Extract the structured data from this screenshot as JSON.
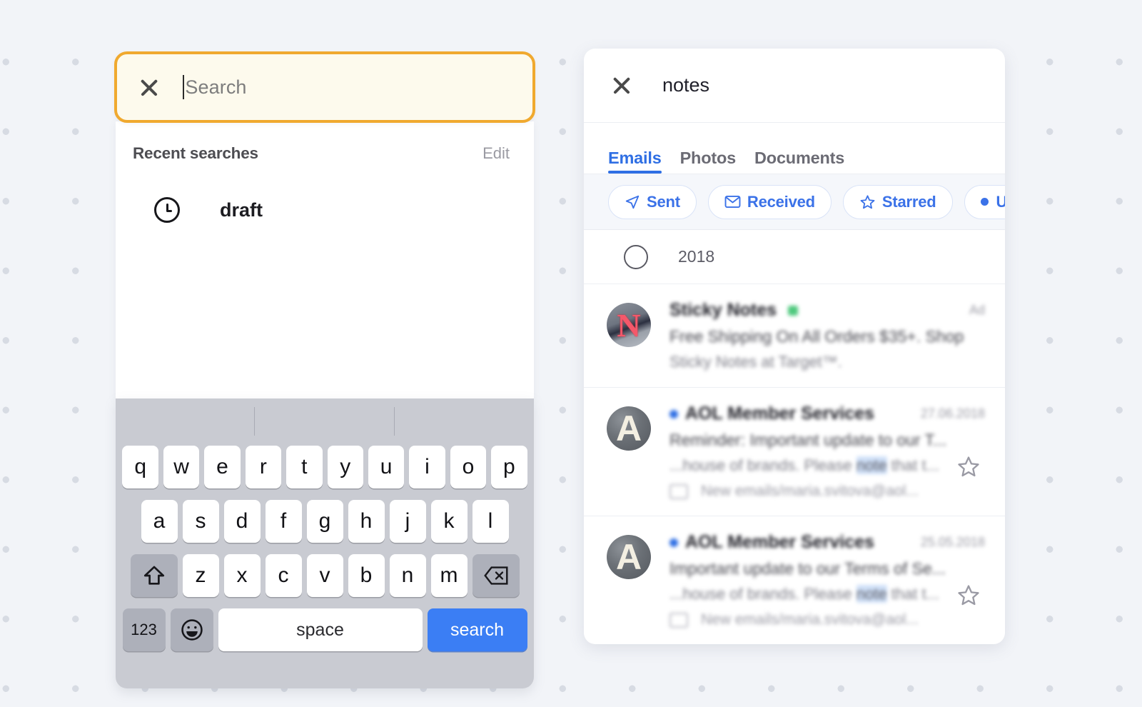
{
  "left_panel": {
    "search": {
      "close_icon": "close-icon",
      "placeholder": "Search",
      "value": ""
    },
    "recent": {
      "title": "Recent searches",
      "edit_label": "Edit",
      "items": [
        {
          "icon": "clock-icon",
          "label": "draft"
        }
      ]
    },
    "keyboard": {
      "rows": [
        [
          "q",
          "w",
          "e",
          "r",
          "t",
          "y",
          "u",
          "i",
          "o",
          "p"
        ],
        [
          "a",
          "s",
          "d",
          "f",
          "g",
          "h",
          "j",
          "k",
          "l"
        ],
        [
          "z",
          "x",
          "c",
          "v",
          "b",
          "n",
          "m"
        ]
      ],
      "shift_icon": "shift-icon",
      "backspace_icon": "backspace-icon",
      "numbers_label": "123",
      "emoji_icon": "emoji-icon",
      "space_label": "space",
      "search_label": "search"
    }
  },
  "right_panel": {
    "header": {
      "close_icon": "close-icon",
      "query": "notes"
    },
    "tabs": [
      {
        "label": "Emails",
        "active": true
      },
      {
        "label": "Photos",
        "active": false
      },
      {
        "label": "Documents",
        "active": false
      }
    ],
    "filter_chips": [
      {
        "label": "Sent",
        "icon": "send-icon"
      },
      {
        "label": "Received",
        "icon": "envelope-icon"
      },
      {
        "label": "Starred",
        "icon": "star-icon"
      },
      {
        "label": "Unread",
        "icon": "dot-icon"
      }
    ],
    "year_group": {
      "checkbox_icon": "circle-checkbox-icon",
      "label": "2018"
    },
    "emails": [
      {
        "avatar_letter": "N",
        "avatar_type": "netflix",
        "unread": false,
        "sender": "Sticky Notes",
        "badge": "green-verified-badge",
        "meta": "Ad",
        "subject": "Free Shipping On All Orders $35+. Shop",
        "snippet_prefix": "Sticky Notes at Target™.",
        "snippet_highlight": "",
        "snippet_suffix": "",
        "folder": "",
        "starred": false
      },
      {
        "avatar_letter": "A",
        "avatar_type": "aol",
        "unread": true,
        "sender": "AOL Member Services",
        "badge": "",
        "meta": "27.06.2018",
        "subject": "Reminder: Important update to our T...",
        "snippet_prefix": "...house of brands. Please ",
        "snippet_highlight": "note",
        "snippet_suffix": " that t...",
        "folder": "New emails/maria.svitova@aol...",
        "starred": true
      },
      {
        "avatar_letter": "A",
        "avatar_type": "aol",
        "unread": true,
        "sender": "AOL Member Services",
        "badge": "",
        "meta": "25.05.2018",
        "subject": "Important update to our Terms of Se...",
        "snippet_prefix": "...house of brands. Please ",
        "snippet_highlight": "note",
        "snippet_suffix": " that t...",
        "folder": "New emails/maria.svitova@aol...",
        "starred": true
      }
    ]
  },
  "colors": {
    "accent_blue": "#2f6fe4",
    "highlight_orange": "#f0a92f",
    "search_fill": "#fdfaed",
    "page_bg": "#f2f4f8",
    "keyboard_bg": "#c9cbd2",
    "unread_dot": "#2f6fe4",
    "green_badge": "#4fc97e"
  }
}
